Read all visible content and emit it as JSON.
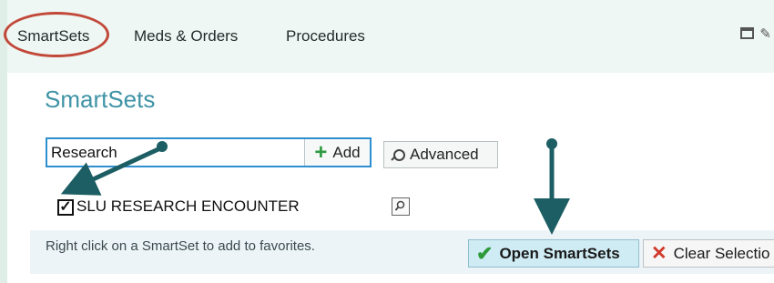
{
  "tabs": [
    "SmartSets",
    "Meds & Orders",
    "Procedures"
  ],
  "section_title": "SmartSets",
  "search": {
    "value": "Research"
  },
  "buttons": {
    "add": "Add",
    "advanced": "Advanced",
    "open": "Open SmartSets",
    "clear": "Clear Selectio"
  },
  "results": [
    {
      "label": "SLU RESEARCH ENCOUNTER",
      "checked": true
    }
  ],
  "hint": "Right click on a SmartSet to add to favorites.",
  "icons": [
    "window-icon",
    "pencil-icon",
    "plus-icon",
    "search-icon",
    "checkbox-icon",
    "preview-icon",
    "checkmark-icon",
    "x-icon"
  ],
  "colors": {
    "tab_background": "#eef7f3",
    "title": "#3f93a6",
    "annotation_circle": "#c2483a",
    "annotation_arrow": "#1c5e63",
    "open_button": "#cfecf4"
  }
}
